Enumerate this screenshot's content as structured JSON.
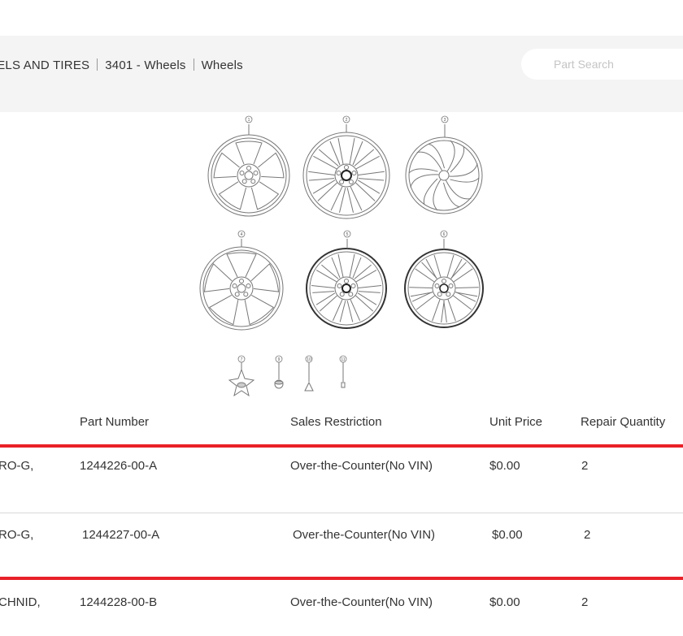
{
  "breadcrumb": {
    "items": [
      "EELS AND TIRES",
      "3401 - Wheels",
      "Wheels"
    ]
  },
  "search": {
    "placeholder": "Part Search"
  },
  "diagram": {
    "callouts": [
      "1",
      "2",
      "3",
      "4",
      "5",
      "6",
      "7",
      "9",
      "10",
      "11"
    ]
  },
  "table": {
    "headers": {
      "part_number": "Part Number",
      "sales_restriction": "Sales Restriction",
      "unit_price": "Unit Price",
      "repair_quantity": "Repair Quantity"
    },
    "rows": [
      {
        "name": "RO-G,",
        "part_number": "1244226-00-A",
        "sales_restriction": "Over-the-Counter(No VIN)",
        "unit_price": "$0.00",
        "quantity": "2"
      },
      {
        "name": "RO-G,",
        "part_number": "1244227-00-A",
        "sales_restriction": "Over-the-Counter(No VIN)",
        "unit_price": "$0.00",
        "quantity": "2"
      },
      {
        "name": "CHNID,",
        "part_number": "1244228-00-B",
        "sales_restriction": "Over-the-Counter(No VIN)",
        "unit_price": "$0.00",
        "quantity": "2"
      }
    ]
  },
  "colors": {
    "highlight": "#e82127",
    "header_bg": "#f4f4f4"
  }
}
